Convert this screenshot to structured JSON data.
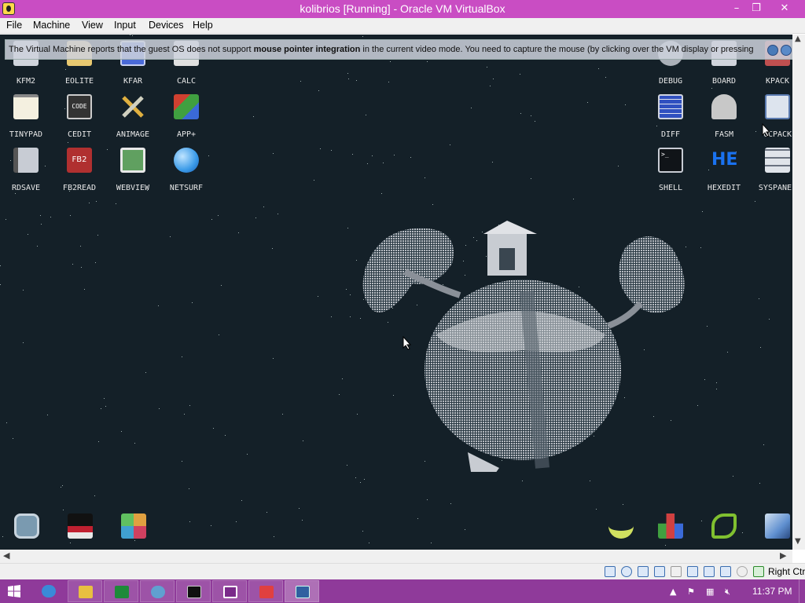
{
  "window": {
    "title": "kolibrios [Running] - Oracle VM VirtualBox",
    "minimize_glyph": "–",
    "maximize_glyph": "❐",
    "close_glyph": "✕"
  },
  "menu": [
    "File",
    "Machine",
    "View",
    "Input",
    "Devices",
    "Help"
  ],
  "notification": {
    "text_before": "The Virtual Machine reports that the guest OS does not support ",
    "text_bold": "mouse pointer integration",
    "text_after": " in the current video mode. You need to capture the mouse (by clicking over the VM display or pressing"
  },
  "desktop_icons": {
    "left": [
      {
        "label": "KFM2",
        "icon": "file-manager-icon",
        "color": "#d0d4dc"
      },
      {
        "label": "EOLITE",
        "icon": "folder-icon",
        "color": "#e8c870"
      },
      {
        "label": "KFAR",
        "icon": "dual-panel-icon",
        "color": "#4a6ad8"
      },
      {
        "label": "CALC",
        "icon": "calculator-icon",
        "color": "#e0e0e0"
      },
      {
        "label": "TINYPAD",
        "icon": "notepad-icon",
        "color": "#f4f0e0"
      },
      {
        "label": "CEDIT",
        "icon": "code-editor-icon",
        "color": "#333333",
        "badge": "CODE"
      },
      {
        "label": "ANIMAGE",
        "icon": "paint-tools-icon",
        "color": "#e0b040"
      },
      {
        "label": "APP+",
        "icon": "cube-icon",
        "color": "#d04030"
      },
      {
        "label": "RDSAVE",
        "icon": "disk-save-icon",
        "color": "#c8ccd4"
      },
      {
        "label": "FB2READ",
        "icon": "book-icon",
        "color": "#b03030",
        "badge": "FB2"
      },
      {
        "label": "WEBVIEW",
        "icon": "globe-page-icon",
        "color": "#60a060"
      },
      {
        "label": "NETSURF",
        "icon": "globe-icon",
        "color": "#3a9ae8"
      }
    ],
    "right": [
      {
        "label": "DEBUG",
        "icon": "gears-icon",
        "color": "#aab0b8"
      },
      {
        "label": "BOARD",
        "icon": "clipboard-icon",
        "color": "#d0d4dc"
      },
      {
        "label": "KPACK",
        "icon": "archive-icon",
        "color": "#c05050"
      },
      {
        "label": "DIFF",
        "icon": "grid-compare-icon",
        "color": "#3050c0"
      },
      {
        "label": "FASM",
        "icon": "hammer-icon",
        "color": "#c8c8c8"
      },
      {
        "label": "CCPACK",
        "icon": "cabinet-icon",
        "color": "#dde4ee"
      },
      {
        "label": "SHELL",
        "icon": "terminal-icon",
        "color": "#101418",
        "badge": ">_"
      },
      {
        "label": "HEXEDIT",
        "icon": "hex-editor-icon",
        "color": "#1a62d8",
        "badge": "HE"
      },
      {
        "label": "SYSPANEL",
        "icon": "sliders-icon",
        "color": "#e0e4ea"
      }
    ],
    "bottom": [
      {
        "label": "",
        "icon": "kolibri-menu-icon",
        "color": "#7a9ab0"
      },
      {
        "label": "",
        "icon": "flag-icon",
        "color": "#c02030"
      },
      {
        "label": "",
        "icon": "mosaic-icon",
        "color": "#e0a040"
      },
      {
        "label": "",
        "icon": "hummingbird-icon",
        "color": "#d0e060"
      },
      {
        "label": "",
        "icon": "blocks-game-icon",
        "color": "#40a040"
      },
      {
        "label": "",
        "icon": "snake-game-icon",
        "color": "#80c030"
      },
      {
        "label": "",
        "icon": "3d-cubes-icon",
        "color": "#6090d0"
      }
    ]
  },
  "statusbar": {
    "host_key": "Right Ctrl",
    "icons": [
      "hdd-icon",
      "cd-icon",
      "audio-icon",
      "network-icon",
      "usb-icon",
      "shared-folder-icon",
      "display-icon",
      "record-icon",
      "vt-x-icon",
      "mouse-integration-icon",
      "keyboard-icon"
    ]
  },
  "taskbar": {
    "start_icon": "windows-start-icon",
    "apps": [
      {
        "name": "internet-explorer-icon",
        "color": "#3a8ad8"
      },
      {
        "name": "file-explorer-icon",
        "color": "#e8c040"
      },
      {
        "name": "excel-icon",
        "color": "#1e8a3a"
      },
      {
        "name": "media-player-icon",
        "color": "#60a0d0"
      },
      {
        "name": "command-prompt-icon",
        "color": "#101010"
      },
      {
        "name": "onenote-icon",
        "color": "#7a2a8a"
      },
      {
        "name": "virtualbox-manager-icon",
        "color": "#e04040"
      },
      {
        "name": "virtualbox-vm-icon",
        "color": "#3060a0"
      }
    ],
    "clock": "11:37 PM"
  },
  "colors": {
    "titlebar": "#c94dc3",
    "taskbar": "#8f3a9a",
    "vm_background": "#142028"
  }
}
